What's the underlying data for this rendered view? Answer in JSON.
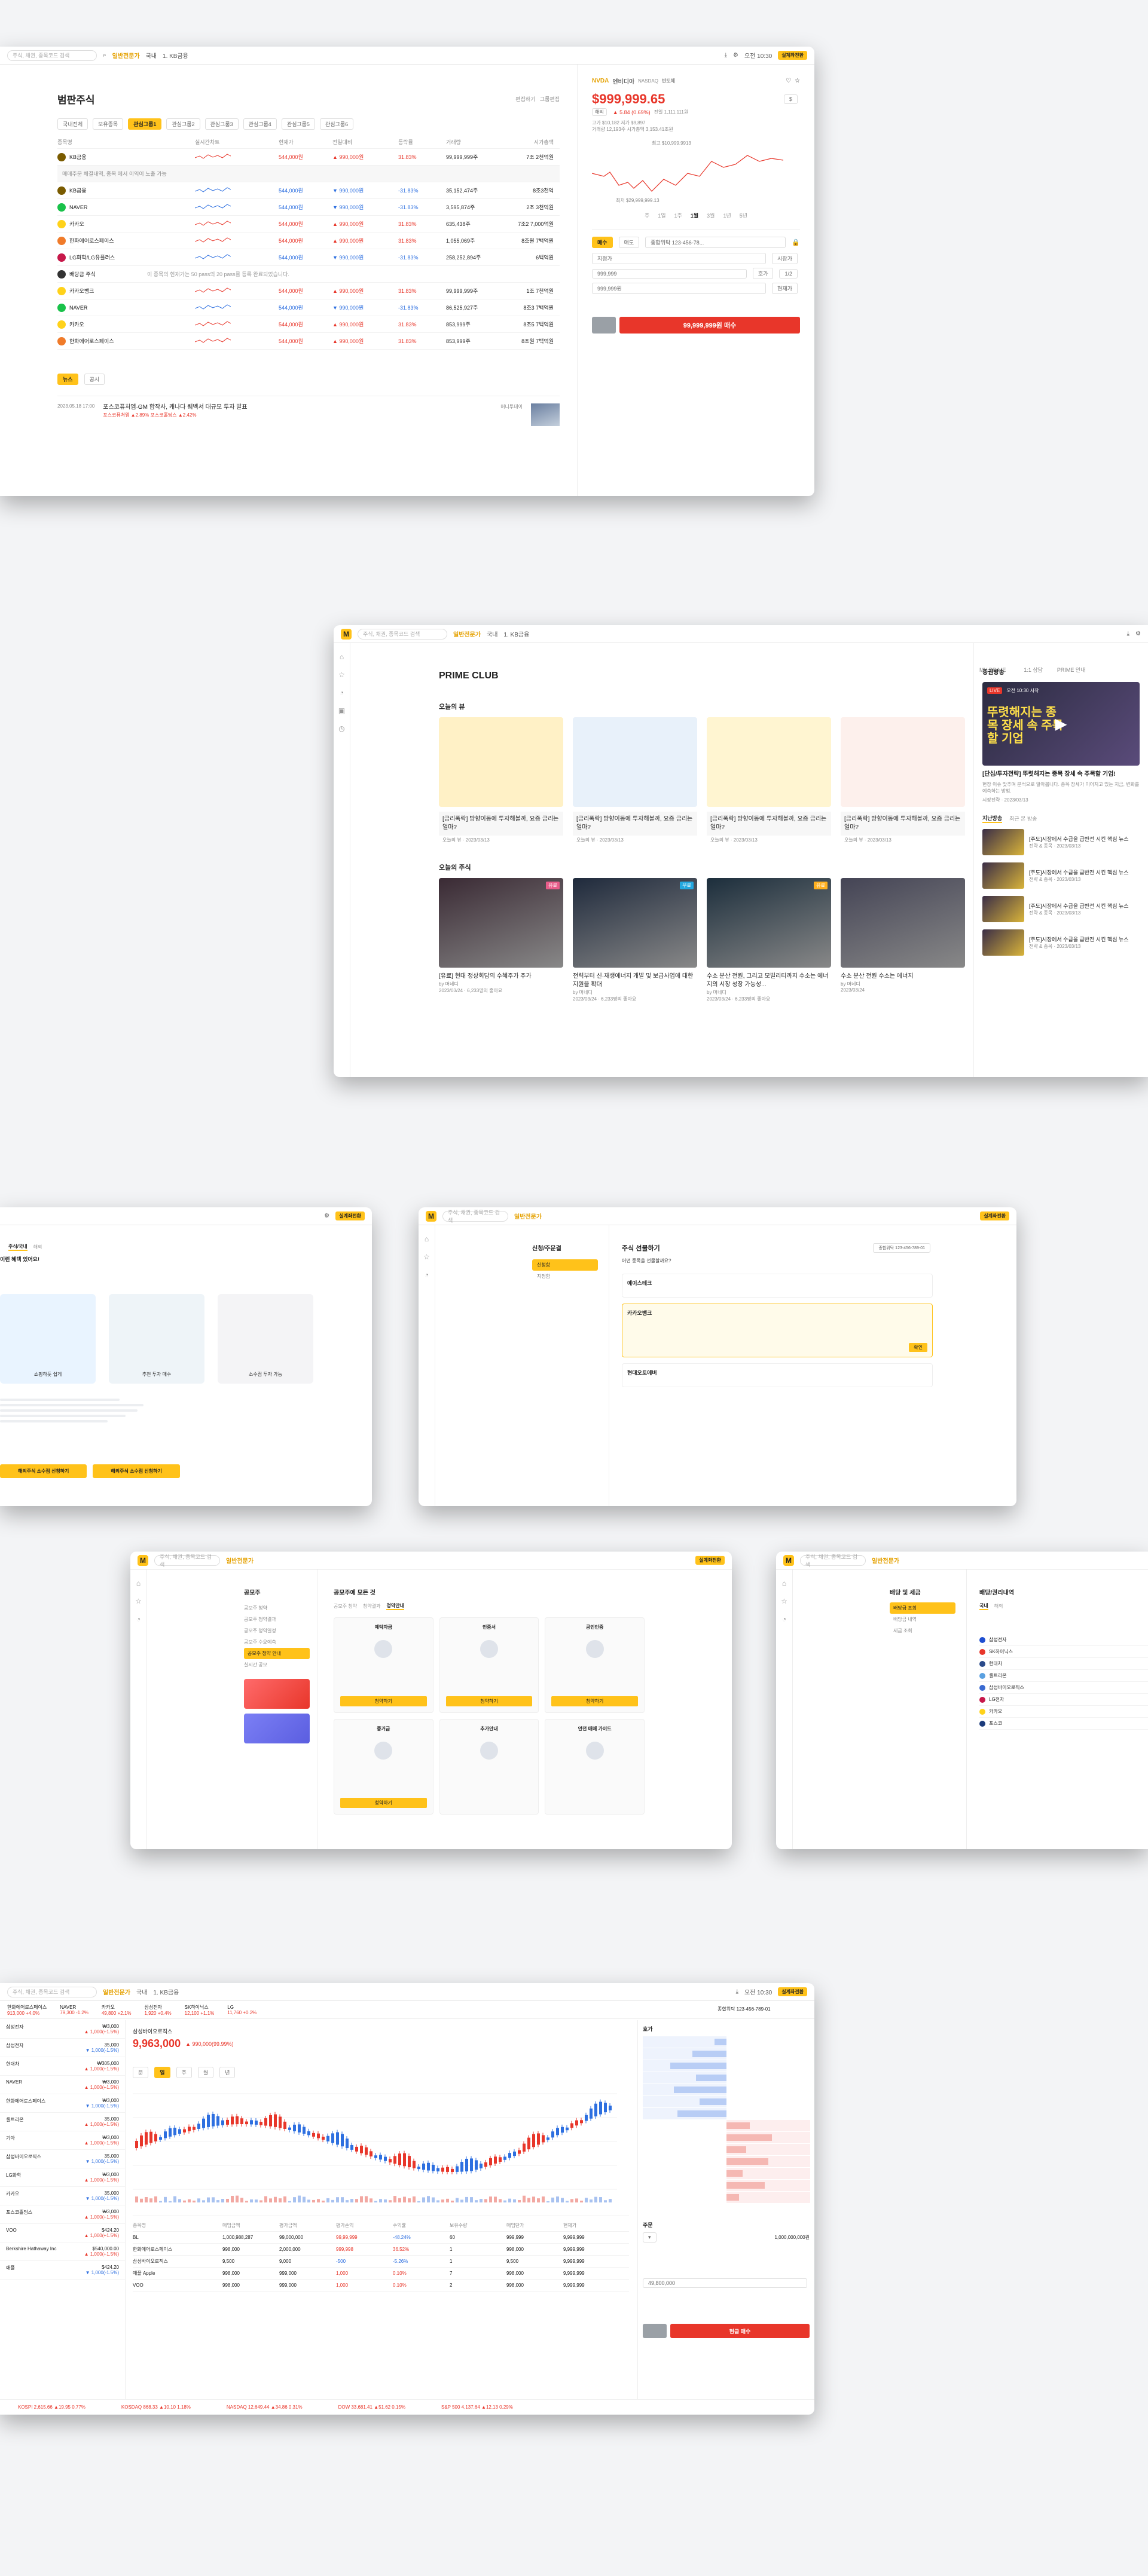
{
  "common": {
    "search_placeholder": "주식, 채권, 종목코드 검색",
    "logo": "M",
    "nav_highlight": "일반전문가",
    "nav_domestic": "국내",
    "nav_market": "1. KB금융",
    "top_button": "실계좌전환",
    "time": "오전 10:30"
  },
  "w1": {
    "title": "범판주식",
    "tabs": [
      "국내전체",
      "보유종목",
      "관심그룹1",
      "관심그룹2",
      "관심그룹3",
      "관심그룹4",
      "관심그룹5",
      "관심그룹6"
    ],
    "links": [
      "편집하기",
      "그룹편집"
    ],
    "col_headers": [
      "종목명",
      "실시간차트",
      "현재가",
      "전일대비",
      "등락률",
      "거래량",
      "시가총액"
    ],
    "notice": "매매주문 체결내역, 종목 에서 이익이 노출 가능",
    "rows": [
      {
        "name": "KB금융",
        "price": "544,000원",
        "change": "▲ 990,000원",
        "rate": "31.83%",
        "vol": "99,999,999주",
        "cap": "7조 2천억원",
        "color": "#7a5b00",
        "dir": "up"
      },
      {
        "name": "KB금융",
        "price": "544,000원",
        "change": "▼ 990,000원",
        "rate": "-31.83%",
        "vol": "35,152,474주",
        "cap": "8조3천억",
        "color": "#7a5b00",
        "dir": "down"
      },
      {
        "name": "NAVER",
        "price": "544,000원",
        "change": "▼ 990,000원",
        "rate": "-31.83%",
        "vol": "3,595,874주",
        "cap": "2조 3천억원",
        "color": "#19c24a",
        "dir": "down"
      },
      {
        "name": "카카오",
        "price": "544,000원",
        "change": "▲ 990,000원",
        "rate": "31.83%",
        "vol": "635,438주",
        "cap": "7조2 7,000억원",
        "color": "#ffd21a",
        "dir": "up"
      },
      {
        "name": "한화에어로스페이스",
        "price": "544,000원",
        "change": "▲ 990,000원",
        "rate": "31.83%",
        "vol": "1,055,069주",
        "cap": "8조원 7백억원",
        "color": "#f07b2a",
        "dir": "up"
      },
      {
        "name": "LG화학/LG유플러스",
        "price": "544,000원",
        "change": "▼ 990,000원",
        "rate": "-31.83%",
        "vol": "258,252,894주",
        "cap": "6백억원",
        "color": "#c7184a",
        "dir": "down"
      },
      {
        "name": "카카오뱅크",
        "price": "544,000원",
        "change": "▲ 990,000원",
        "rate": "31.83%",
        "vol": "99,999,999주",
        "cap": "1조 7천억원",
        "color": "#ffd21a",
        "dir": "up"
      },
      {
        "name": "NAVER",
        "price": "544,000원",
        "change": "▼ 990,000원",
        "rate": "-31.83%",
        "vol": "86,525,927주",
        "cap": "8조3 7백억원",
        "color": "#19c24a",
        "dir": "down"
      },
      {
        "name": "카카오",
        "price": "544,000원",
        "change": "▲ 990,000원",
        "rate": "31.83%",
        "vol": "853,999주",
        "cap": "8조5 7백억원",
        "color": "#ffd21a",
        "dir": "up"
      },
      {
        "name": "한화에어로스페이스",
        "price": "544,000원",
        "change": "▲ 990,000원",
        "rate": "31.83%",
        "vol": "853,999주",
        "cap": "8조원 7백억원",
        "color": "#f07b2a",
        "dir": "up"
      }
    ],
    "info_row": "배당금 주식",
    "info_text": "이 종목의 현재가는 50 pass의 20 pass를 등록 완료되었습니다.",
    "chips": [
      "뉴스",
      "공시"
    ],
    "news_date": "2023.05.18 17:00",
    "news_title": "포스코퓨처엠·GM 합작사, 캐나다 퀘벡서 대규모 투자 발표",
    "news_tags": "포스코퓨처엠 ▲2.89%  포스코홀딩스 ▲2.42%",
    "news_source": "머니투데이",
    "right": {
      "ticker": "NVDA",
      "name": "엔비디아",
      "badges": [
        "NASDAQ",
        "반도체"
      ],
      "price": "$999,999.65",
      "change_badge": "해외",
      "change": "▲ 5.84 (0.69%)",
      "after": "전일 1,111,111원",
      "sub1": "고가 $10,182  저가 $9,897",
      "sub2": "거래량 12,193주  시가총액 3,153.41조원",
      "tags": [
        "주",
        "1일",
        "1주",
        "1월",
        "3월",
        "1년",
        "5년"
      ],
      "chart_high": "최고 $10,999.9913",
      "chart_low": "최저 $29,999,999.13",
      "tabs": [
        "매수",
        "매도"
      ],
      "account": "종합위탁 123-456-78...",
      "order_type": "지정가",
      "market": "시장가",
      "qty": "999,999",
      "price_in": "999,999원",
      "labels": [
        "현재가",
        "호가",
        "보유",
        "1/2",
        "최대"
      ],
      "order_button": "99,999,999원 매수"
    }
  },
  "w2": {
    "title": "PRIME CLUB",
    "links": [
      "MY PRIME",
      "1:1 상담",
      "PRIME 안내"
    ],
    "sec1": "오늘의 뷰",
    "cards1": [
      {
        "title": "[금리폭락] 방향이동에 투자해볼까, 요즘 금리는 얼마?",
        "meta": "오늘의 뷰  ·  2023/03/13",
        "bg": "#fff1c6"
      },
      {
        "title": "[금리폭락] 방향이동에 투자해볼까, 요즘 금리는 얼마?",
        "meta": "오늘의 뷰  ·  2023/03/13",
        "bg": "#e8f1fa"
      },
      {
        "title": "[금리폭락] 방향이동에 투자해볼까, 요즘 금리는 얼마?",
        "meta": "오늘의 뷰  ·  2023/03/13",
        "bg": "#fff5d1"
      },
      {
        "title": "[금리폭락] 방향이동에 투자해볼까, 요즘 금리는 얼마?",
        "meta": "오늘의 뷰  ·  2023/03/13",
        "bg": "#fdf0ec"
      }
    ],
    "sec2": "오늘의 주식",
    "cards2": [
      {
        "title": "[유료] 현대 정상회담의 수혜주가 주가",
        "meta": "by 머네디",
        "date": "2023/03/24  ·  6,233명의 좋아요",
        "badge": "유료",
        "bg": "#3a2a34",
        "badgeColor": "#e85d8a"
      },
      {
        "title": "전력부터 신·재생에너지 개발 및 보급사업에 대한 지원을 확대",
        "meta": "by 머네디",
        "date": "2023/03/24  ·  6,233명의 좋아요",
        "badge": "무료",
        "bg": "#1f2a3c",
        "badgeColor": "#23a8e0"
      },
      {
        "title": "수소 분산 전원, 그리고 모빌리티까지 수소는 에너지의 시장 성장 가능성...",
        "meta": "by 머네디",
        "date": "2023/03/24  ·  6,233명의 좋아요",
        "badge": "유료",
        "bg": "#1c2e3c",
        "badgeColor": "#ffb01f"
      },
      {
        "title": "수소 분산 전원 수소는 에너지",
        "meta": "by 머네디",
        "date": "2023/03/24",
        "badge": "",
        "bg": "#445",
        "badgeColor": "#ffb01f"
      }
    ],
    "right_title": "증권방송",
    "live_badge": "LIVE",
    "live_time": "오전 10:30 시작",
    "live_headline": "뚜렷해지는 종목 장세 속 주목할 기업",
    "live_title": "[단십/투자전략] 뚜렷해지는 종목 장세 속 주목할 기업!",
    "live_desc": "현장 이슈 맞추며 분석으로 알아봅니다. 종목 장세가 이어지고 있는 지금, 변화를 예측하는 방법.",
    "live_meta": "시장전략  ·  2023/03/13",
    "tabs": [
      "지난방송",
      "최근 본 방송"
    ],
    "videos": [
      {
        "title": "[주도]시장에서 수급을 급반전 시킨 핵심 뉴스",
        "meta": "전략 & 종목  ·  2023/03/13"
      },
      {
        "title": "[주도]시장에서 수급을 급반전 시킨 핵심 뉴스",
        "meta": "전략 & 종목  ·  2023/03/13"
      },
      {
        "title": "[주도]시장에서 수급을 급반전 시킨 핵심 뉴스",
        "meta": "전략 & 종목  ·  2023/03/13"
      },
      {
        "title": "[주도]시장에서 수급을 급반전 시킨 핵심 뉴스",
        "meta": "전략 & 종목  ·  2023/03/13"
      }
    ]
  },
  "w3": {
    "tabs": [
      "주식/국내",
      "해외"
    ],
    "question": "이런 혜택 있어요!",
    "cards": [
      "쇼핑하듯 쉽게",
      "추천 투자 매수",
      "소수점 투자 가능"
    ],
    "buttons": [
      "해외주식 소수점 신청하기",
      "해외주식 소수점 신청하기"
    ]
  },
  "w4": {
    "left_title": "신청/주문결",
    "left_items": [
      "신청함",
      "지정함"
    ],
    "title": "주식 선물하기",
    "sub": "어떤 종목을 선물할까요?",
    "account": "종합위탁 123-456-789-01",
    "items": [
      "에이스테크",
      "카카오뱅크",
      "현대오토에버"
    ],
    "confirm": "확인"
  },
  "w5": {
    "left_title": "공모주",
    "left_items": [
      "공모주 청약",
      "공모주 청약결과",
      "공모주 청약일정",
      "공모주 수요예측",
      "공모주 청약 안내",
      "실시간 공모"
    ],
    "title": "공모주에 모든 것",
    "tabs": [
      "공모주 청약",
      "청약결과",
      "청약안내"
    ],
    "cards": [
      {
        "title": "예탁자금",
        "btn": "청약하기"
      },
      {
        "title": "인증서",
        "btn": "청약하기"
      },
      {
        "title": "공인인증",
        "btn": "청약하기"
      },
      {
        "title": "증거금",
        "btn": "청약하기"
      },
      {
        "title": "추가안내",
        "btn": ""
      },
      {
        "title": "안전 매매 가이드",
        "btn": ""
      }
    ]
  },
  "w6": {
    "left_title": "배당 및 세금",
    "left_items": [
      "배당금 조회",
      "배당금 내역",
      "세금 조회"
    ],
    "title": "배당/권리내역",
    "tabs": [
      "국내",
      "해외"
    ],
    "rows": [
      "삼성전자",
      "SK하이닉스",
      "현대차",
      "셀트리온",
      "삼성바이오로직스",
      "LG전자",
      "카카오",
      "포스코"
    ]
  },
  "w7": {
    "account": "종합위탁 123-456-789-01",
    "tickers": [
      {
        "name": "한화에어로스페이스",
        "price": "913,000",
        "chg": "+4.0%"
      },
      {
        "name": "NAVER",
        "price": "79,300",
        "chg": "-1.2%"
      },
      {
        "name": "카카오",
        "price": "49,800",
        "chg": "+2.1%"
      },
      {
        "name": "삼성전자",
        "price": "1,920",
        "chg": "+0.4%"
      },
      {
        "name": "SK하이닉스",
        "price": "12,100",
        "chg": "+1.1%"
      },
      {
        "name": "LG",
        "price": "11,760",
        "chg": "+0.2%"
      }
    ],
    "sidebar_items": [
      {
        "name": "삼성전자",
        "price": "₩3,000",
        "chg": "▲ 1,000(+1.5%)"
      },
      {
        "name": "삼성전자",
        "price": "35,000",
        "chg": "▼ 1,000(-1.5%)"
      },
      {
        "name": "현대차",
        "price": "₩305,000",
        "chg": "▲ 1,000(+1.5%)"
      },
      {
        "name": "NAVER",
        "price": "₩3,000",
        "chg": "▲ 1,000(+1.5%)"
      },
      {
        "name": "한화에어로스페이스",
        "price": "₩3,000",
        "chg": "▼ 1,000(-1.5%)"
      },
      {
        "name": "셀트리온",
        "price": "35,000",
        "chg": "▲ 1,000(+1.5%)"
      },
      {
        "name": "기아",
        "price": "₩3,000",
        "chg": "▲ 1,000(+1.5%)"
      },
      {
        "name": "삼성바이오로직스",
        "price": "35,000",
        "chg": "▼ 1,000(-1.5%)"
      },
      {
        "name": "LG화학",
        "price": "₩3,000",
        "chg": "▲ 1,000(+1.5%)"
      },
      {
        "name": "카카오",
        "price": "35,000",
        "chg": "▼ 1,000(-1.5%)"
      },
      {
        "name": "포스코홀딩스",
        "price": "₩3,000",
        "chg": "▲ 1,000(+1.5%)"
      },
      {
        "name": "VOO",
        "price": "$424.20",
        "chg": "▲ 1,000(+1.5%)"
      },
      {
        "name": "Berkshire Hathaway Inc",
        "price": "$540,000.00",
        "chg": "▲ 1,000(+1.5%)"
      },
      {
        "name": "애플",
        "price": "$424.20",
        "chg": "▼ 1,000(-1.5%)"
      }
    ],
    "stock_name": "삼성바이오로직스",
    "stock_price": "9,963,000",
    "stock_change": "▲ 990,000(99.99%)",
    "chart_tabs": [
      "분",
      "일",
      "주",
      "월",
      "년"
    ],
    "orderbook_title": "호가",
    "order_title": "주문",
    "order_amount": "1,000,000,000원",
    "order_price": "49,800,000",
    "order_button": "현금 매수",
    "footer": [
      "KOSPI 2,615.66 ▲19.95 0.77%",
      "KOSDAQ 868.33 ▲10.10 1.18%",
      "NASDAQ 12,649.44 ▲34.86 0.31%",
      "DOW 33,681.41 ▲51.62 0.15%",
      "S&P 500 4,137.64 ▲12.13 0.29%"
    ],
    "table_headers": [
      "종목명",
      "매입금액",
      "평가금액",
      "평가손익",
      "수익률",
      "보유수량",
      "매입단가",
      "현재가"
    ],
    "table_rows": [
      {
        "name": "BL",
        "c1": "1,000,988,287",
        "c2": "99,000,000",
        "c3": "99,99,999",
        "c4": "-48.24%",
        "c5": "60",
        "c6": "999,999",
        "c7": "9,999,999"
      },
      {
        "name": "한화에어로스페이스",
        "c1": "998,000",
        "c2": "2,000,000",
        "c3": "999,998",
        "c4": "36.52%",
        "c5": "1",
        "c6": "998,000",
        "c7": "9,999,999"
      },
      {
        "name": "삼성바이오로직스",
        "c1": "9,500",
        "c2": "9,000",
        "c3": "-500",
        "c4": "-5.26%",
        "c5": "1",
        "c6": "9,500",
        "c7": "9,999,999"
      },
      {
        "name": "애플 Apple",
        "c1": "998,000",
        "c2": "999,000",
        "c3": "1,000",
        "c4": "0.10%",
        "c5": "7",
        "c6": "998,000",
        "c7": "9,999,999"
      },
      {
        "name": "VOO",
        "c1": "998,000",
        "c2": "999,000",
        "c3": "1,000",
        "c4": "0.10%",
        "c5": "2",
        "c6": "998,000",
        "c7": "9,999,999"
      }
    ]
  },
  "colors": {
    "accent": "#ffc21a",
    "up": "#e8362a",
    "down": "#2d6fe0"
  }
}
